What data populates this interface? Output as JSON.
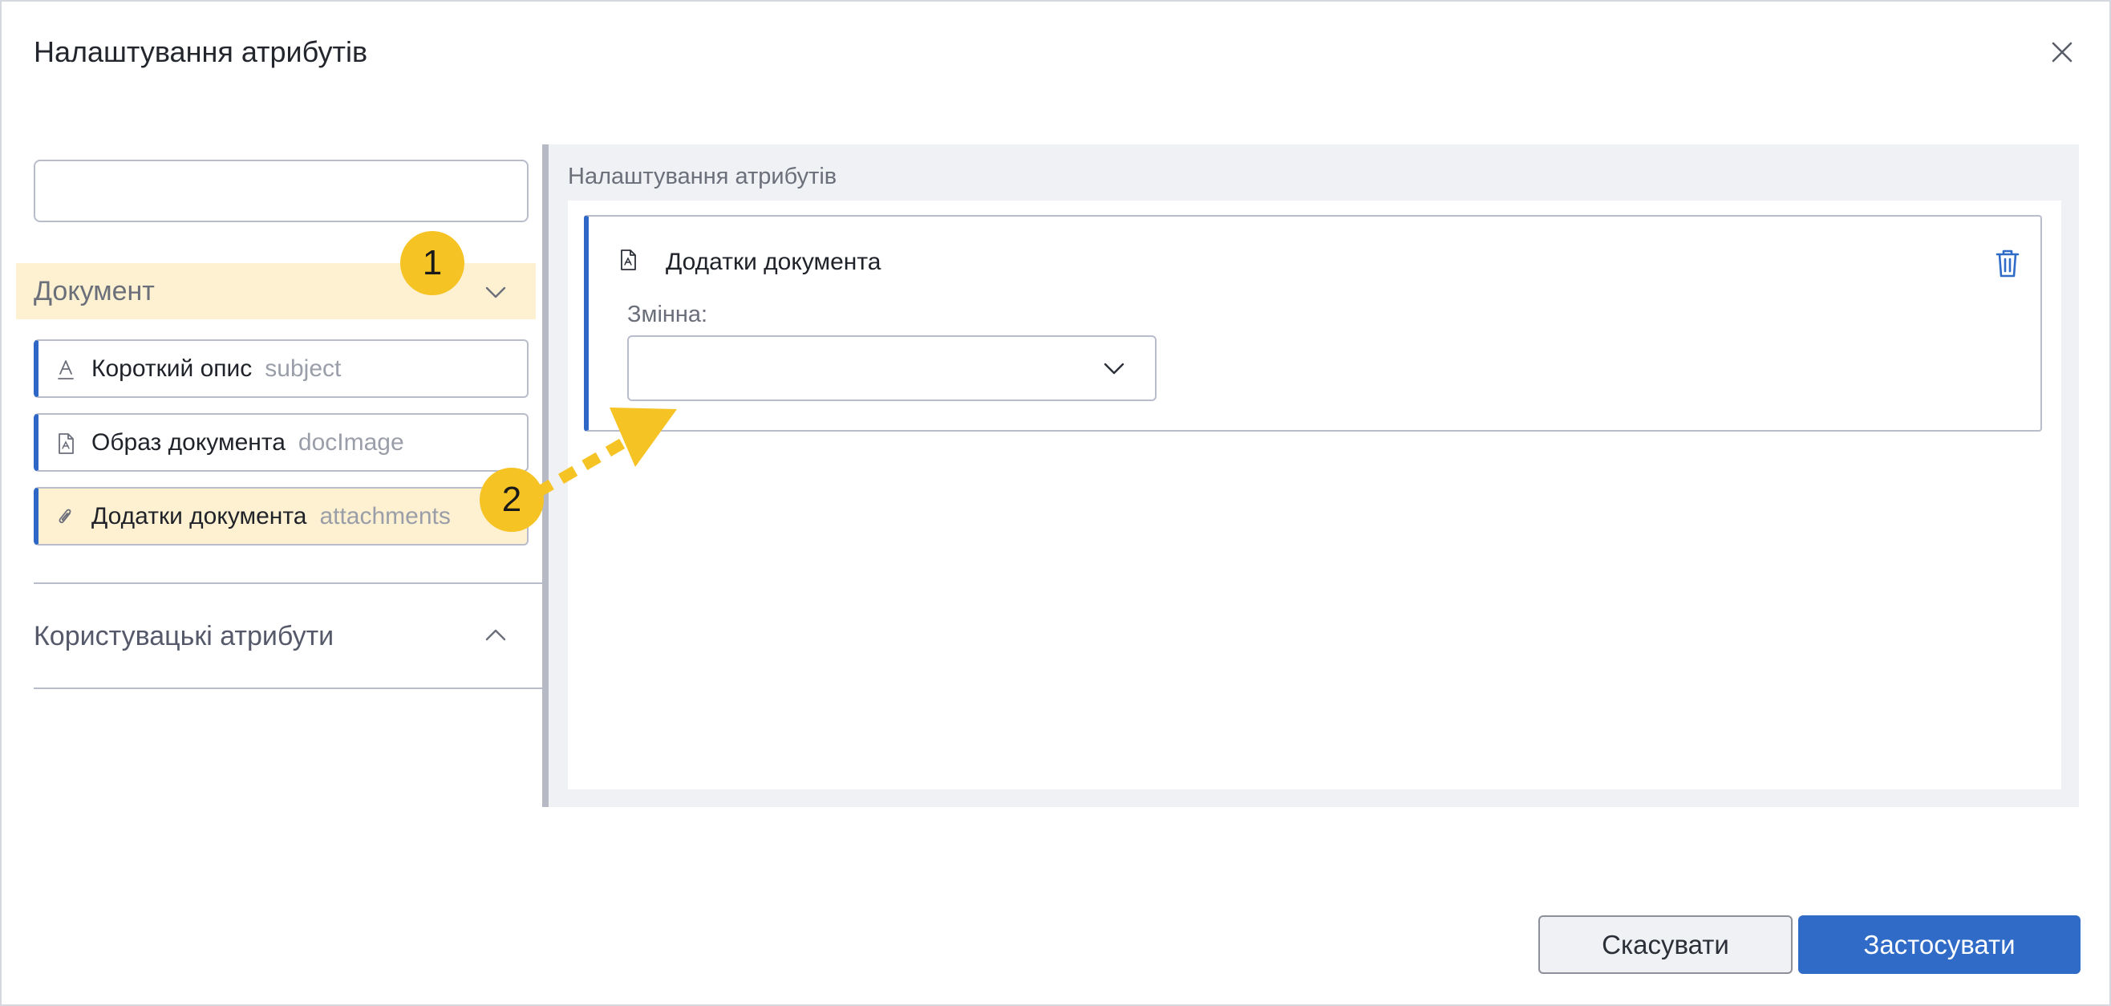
{
  "dialog": {
    "title": "Налаштування атрибутів",
    "close_icon": "close-icon"
  },
  "left": {
    "search": {
      "value": "",
      "placeholder": ""
    },
    "groups": [
      {
        "label": "Документ",
        "expanded": true,
        "items": [
          {
            "name": "Короткий опис",
            "code": "subject",
            "icon": "text-icon"
          },
          {
            "name": "Образ документа",
            "code": "docImage",
            "icon": "pdf-file-icon"
          },
          {
            "name": "Додатки документа",
            "code": "attachments",
            "icon": "paperclip-icon",
            "selected": true
          }
        ]
      },
      {
        "label": "Користувацькі атрибути",
        "expanded": false
      }
    ]
  },
  "right": {
    "title": "Налаштування атрибутів",
    "card": {
      "title": "Додатки документа",
      "icon": "pdf-file-icon",
      "variable_label": "Змінна:",
      "variable_value": ""
    }
  },
  "footer": {
    "cancel_label": "Скасувати",
    "apply_label": "Застосувати"
  },
  "annotations": {
    "badge_1": "1",
    "badge_2": "2"
  },
  "colors": {
    "accent": "#2f6bc7",
    "highlight": "#fdf1d1",
    "annotation": "#f6c324"
  }
}
